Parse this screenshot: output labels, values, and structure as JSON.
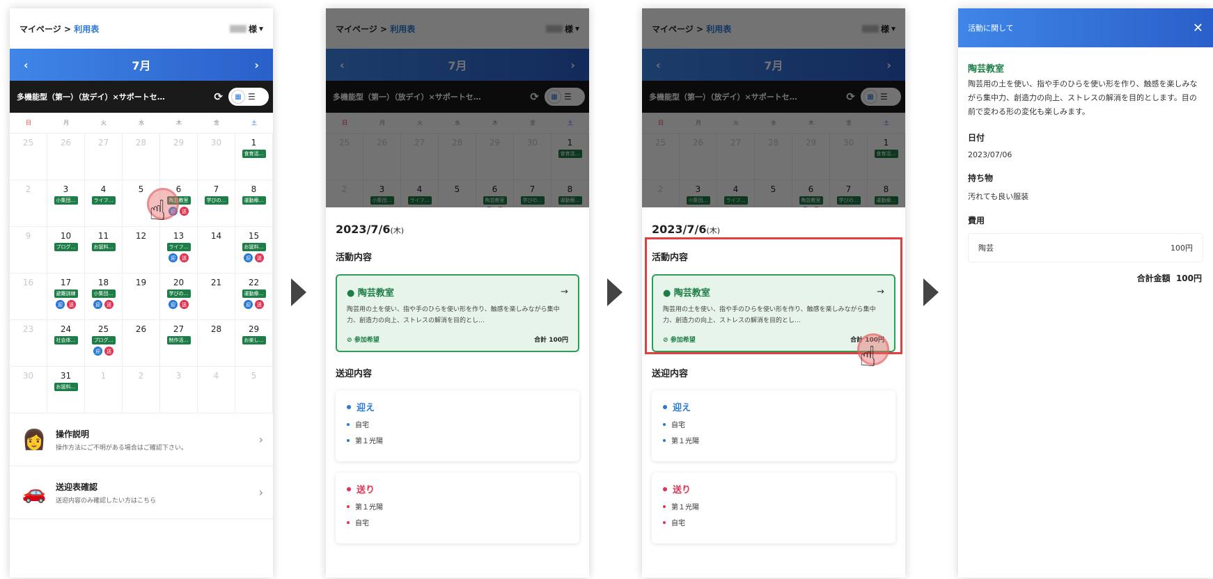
{
  "header": {
    "breadcrumb_home": "マイページ",
    "breadcrumb_sep": " > ",
    "breadcrumb_current": "利用表",
    "user_suffix": "様"
  },
  "calendar": {
    "month": "7月",
    "prev": "‹",
    "next": "›",
    "facility": "多機能型（第一）（放デイ）×サポートセ…",
    "weekdays": [
      "日",
      "月",
      "火",
      "水",
      "木",
      "金",
      "土"
    ],
    "weeks": [
      [
        {
          "d": "25",
          "m": 1
        },
        {
          "d": "26",
          "m": 1
        },
        {
          "d": "27",
          "m": 1
        },
        {
          "d": "28",
          "m": 1
        },
        {
          "d": "29",
          "m": 1
        },
        {
          "d": "30",
          "m": 1
        },
        {
          "d": "1",
          "tag": "食育活…"
        }
      ],
      [
        {
          "d": "2",
          "m": 1
        },
        {
          "d": "3",
          "tag": "小集団…"
        },
        {
          "d": "4",
          "tag": "ライフ…"
        },
        {
          "d": "5"
        },
        {
          "d": "6",
          "tag": "陶芸教室",
          "dots": 1
        },
        {
          "d": "7",
          "tag": "学びの…"
        },
        {
          "d": "8",
          "tag": "運動療…"
        }
      ],
      [
        {
          "d": "9",
          "m": 1
        },
        {
          "d": "10",
          "tag": "プログ…"
        },
        {
          "d": "11",
          "tag": "お誕料…"
        },
        {
          "d": "12"
        },
        {
          "d": "13",
          "tag": "ライフ…",
          "dots": 1
        },
        {
          "d": "14"
        },
        {
          "d": "15",
          "tag": "お誕料…",
          "dots": 1
        }
      ],
      [
        {
          "d": "16",
          "m": 1
        },
        {
          "d": "17",
          "tag": "避難訓練",
          "dots": 1
        },
        {
          "d": "18",
          "tag": "小集団…",
          "dots": 1
        },
        {
          "d": "19"
        },
        {
          "d": "20",
          "tag": "学びの…",
          "dots": 1
        },
        {
          "d": "21"
        },
        {
          "d": "22",
          "tag": "運動療…",
          "dots": 1
        }
      ],
      [
        {
          "d": "23",
          "m": 1
        },
        {
          "d": "24",
          "tag": "社会体…"
        },
        {
          "d": "25",
          "tag": "プログ…",
          "dots": 1
        },
        {
          "d": "26"
        },
        {
          "d": "27",
          "tag": "制作活…"
        },
        {
          "d": "28"
        },
        {
          "d": "29",
          "tag": "お楽し…"
        }
      ],
      [
        {
          "d": "30",
          "m": 1
        },
        {
          "d": "31",
          "tag": "お誕料…"
        },
        {
          "d": "1",
          "m": 1
        },
        {
          "d": "2",
          "m": 1
        },
        {
          "d": "3",
          "m": 1
        },
        {
          "d": "4",
          "m": 1
        },
        {
          "d": "5",
          "m": 1
        }
      ]
    ],
    "dot_labels": [
      "迎",
      "送"
    ]
  },
  "menu": [
    {
      "title": "操作説明",
      "sub": "操作方法にご不明がある場合はご確認下さい。"
    },
    {
      "title": "送迎表確認",
      "sub": "送迎内容のみ確認したい方はこちら"
    }
  ],
  "day": {
    "date": "2023/7/6",
    "dow": "(木)",
    "activity_heading": "活動内容",
    "activity_name": "陶芸教室",
    "activity_desc": "陶芸用の土を使い、指や手のひらを使い形を作り、触感を楽しみながら集中力、創造力の向上、ストレスの解消を目的とし…",
    "status": "参加希望",
    "total": "合計 100円",
    "transfer_heading": "送迎内容",
    "pickup": {
      "title": "迎え",
      "stops": [
        "自宅",
        "第１光陽"
      ]
    },
    "dropoff": {
      "title": "送り",
      "stops": [
        "第１光陽",
        "自宅"
      ]
    }
  },
  "detail": {
    "header": "活動に関して",
    "name": "陶芸教室",
    "desc": "陶芸用の土を使い、指や手のひらを使い形を作り、触感を楽しみながら集中力、創造力の向上、ストレスの解消を目的とします。目の前で変わる形の変化も楽しみます。",
    "date_label": "日付",
    "date": "2023/07/06",
    "items_label": "持ち物",
    "items": "汚れても良い服装",
    "fee_label": "費用",
    "fee_name": "陶芸",
    "fee_amount": "100円",
    "total_label": "合計金額",
    "total": "100円"
  }
}
